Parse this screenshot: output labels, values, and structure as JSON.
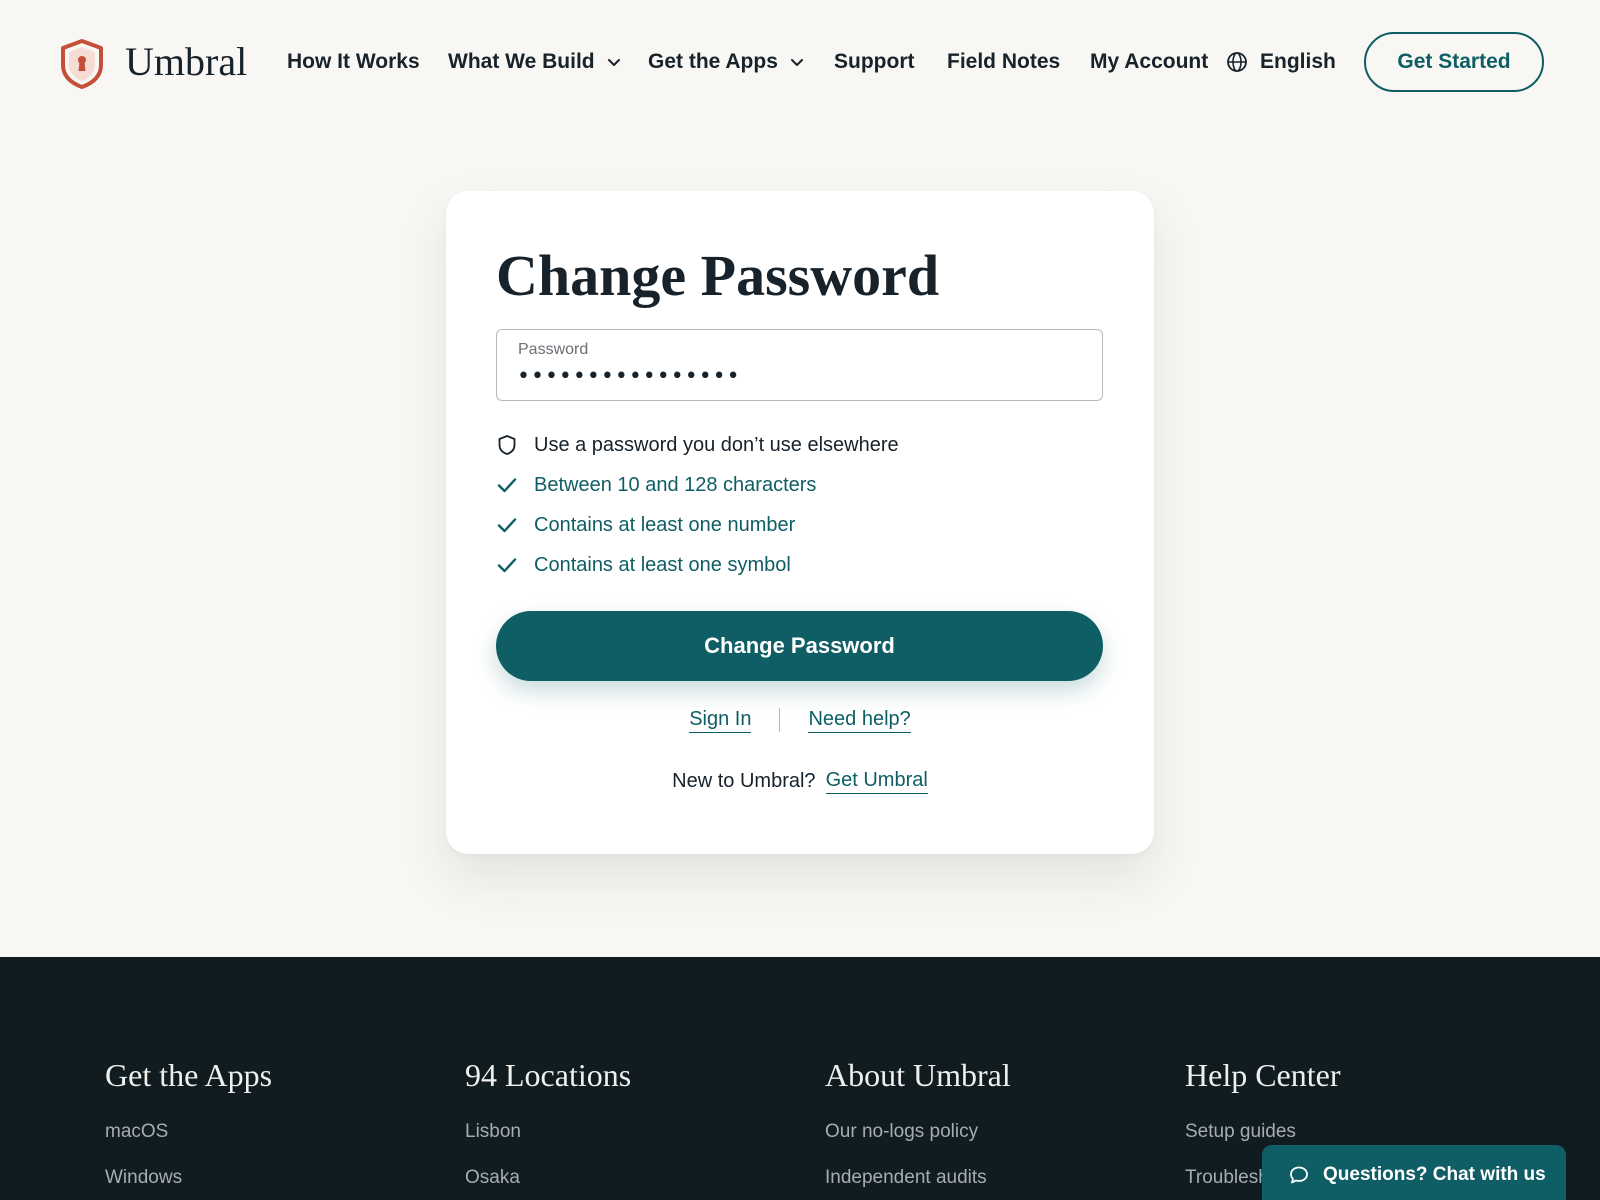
{
  "header": {
    "brand": "Umbral",
    "nav": [
      {
        "label": "How It Works"
      },
      {
        "label": "What We Build"
      },
      {
        "label": "Get the Apps"
      },
      {
        "label": "Support"
      },
      {
        "label": "Field Notes"
      },
      {
        "label": "My Account"
      }
    ],
    "language": "English",
    "cta": "Get Started"
  },
  "form": {
    "title": "Change Password",
    "password_label": "Password",
    "password_value": "••••••••••••••••",
    "requirements": [
      {
        "text": "Use a password you don’t use elsewhere",
        "state": "neutral",
        "icon": "shield-icon"
      },
      {
        "text": "Between 10 and 128 characters",
        "state": "met",
        "icon": "check-icon"
      },
      {
        "text": "Contains at least one number",
        "state": "met",
        "icon": "check-icon"
      },
      {
        "text": "Contains at least one symbol",
        "state": "met",
        "icon": "check-icon"
      }
    ],
    "submit": "Change Password",
    "sign_in": "Sign In",
    "need_help": "Need help?",
    "new_prompt": "New to Umbral?",
    "get_umbral": "Get Umbral"
  },
  "footer": {
    "columns": [
      {
        "heading": "Get the Apps",
        "links": [
          "macOS",
          "Windows"
        ]
      },
      {
        "heading": "94 Locations",
        "links": [
          "Lisbon",
          "Osaka"
        ]
      },
      {
        "heading": "About Umbral",
        "links": [
          "Our no-logs policy",
          "Independent audits"
        ]
      },
      {
        "heading": "Help Center",
        "links": [
          "Setup guides",
          "Troubleshooting"
        ]
      }
    ]
  },
  "chat": {
    "label": "Questions? Chat with us"
  },
  "colors": {
    "brand_accent": "#0f5e65",
    "logo_red": "#c4503a",
    "page_bg": "#f8f7f3",
    "footer_bg": "#111c21"
  }
}
